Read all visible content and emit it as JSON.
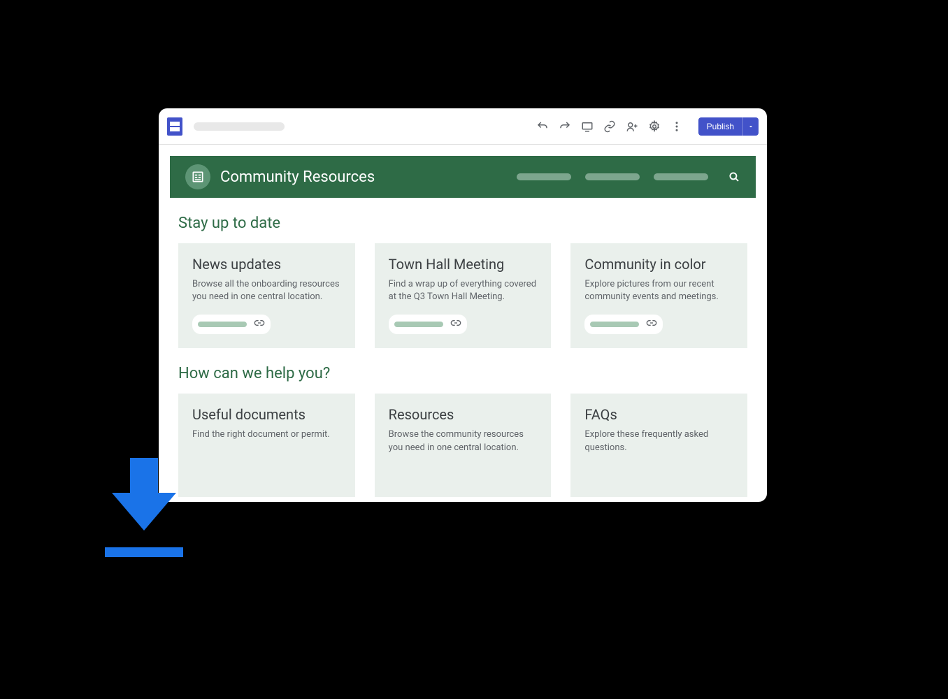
{
  "toolbar": {
    "publish_label": "Publish"
  },
  "site": {
    "title": "Community Resources"
  },
  "sections": {
    "s1": {
      "title": "Stay up to date",
      "cards": {
        "c1": {
          "title": "News updates",
          "desc": "Browse all the onboarding resources you need in one central location."
        },
        "c2": {
          "title": "Town Hall Meeting",
          "desc": "Find a wrap up of everything covered at the Q3 Town Hall Meeting."
        },
        "c3": {
          "title": "Community in color",
          "desc": "Explore pictures from our recent community events and meetings."
        }
      }
    },
    "s2": {
      "title": "How can we help you?",
      "cards": {
        "c1": {
          "title": "Useful documents",
          "desc": "Find the right document or permit."
        },
        "c2": {
          "title": "Resources",
          "desc": "Browse the community resources you need in one central location."
        },
        "c3": {
          "title": "FAQs",
          "desc": "Explore these frequently asked questions."
        }
      }
    }
  }
}
